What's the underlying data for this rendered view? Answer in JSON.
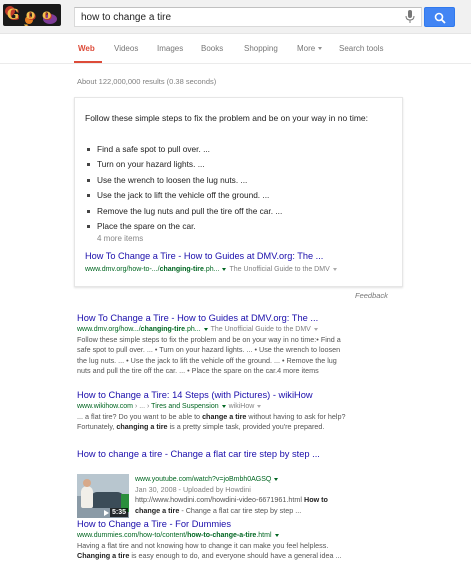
{
  "search": {
    "query": "how to change a tire",
    "logo_text": "G␣␣GLE"
  },
  "tabs": [
    {
      "label": "Web",
      "active": true
    },
    {
      "label": "Videos"
    },
    {
      "label": "Images"
    },
    {
      "label": "Books"
    },
    {
      "label": "Shopping"
    },
    {
      "label": "More"
    },
    {
      "label": "Search tools"
    }
  ],
  "stats": "About 122,000,000 results (0.38 seconds)",
  "answer_card": {
    "intro": "Follow these simple steps to fix the problem and be on your way in no time:",
    "steps": [
      "Find a safe spot to pull over. ...",
      "Turn on your hazard lights. ...",
      "Use the wrench to loosen the lug nuts. ...",
      "Use the jack to lift the vehicle off the ground. ...",
      "Remove the lug nuts and pull the tire off the car. ...",
      "Place the spare on the car."
    ],
    "more_items": "4 more items",
    "title": "How To Change a Tire - How to Guides at DMV.org: The ...",
    "url_prefix": "www.dmv.org/how-to-.../",
    "url_bold": "changing-tire",
    "url_suffix": ".ph...",
    "source": "The Unofficial Guide to the DMV",
    "feedback": "Feedback"
  },
  "results": [
    {
      "title": "How To Change a Tire - How to Guides at DMV.org: The ...",
      "url_prefix": "www.dmv.org/how.../",
      "url_bold": "changing-tire",
      "url_suffix": ".ph...",
      "source": "The Unofficial Guide to the DMV",
      "snippet_1": "Follow these simple steps to fix the problem and be on your way in no time:• Find a",
      "snippet_2": "safe spot to pull over. ... • Turn on your hazard lights. ... • Use the wrench to loosen",
      "snippet_3": "the lug nuts. ... • Use the jack to lift the vehicle off the ground. ... • Remove the lug",
      "snippet_4": "nuts and pull the tire off the car. ... • Place the spare on the car.4 more items"
    },
    {
      "title": "How to Change a Tire: 14 Steps (with Pictures) - wikiHow",
      "url": "www.wikihow.com",
      "breadcrumb_sep": " › ... › ",
      "breadcrumb": "Tires and Suspension",
      "source": "wikiHow",
      "snippet_1": "... a flat tire? Do you want to be able to ",
      "snippet_1_bold": "change a tire",
      "snippet_1_end": " without having to ask for help?",
      "snippet_2": "Fortunately, ",
      "snippet_2_bold": "changing a tire",
      "snippet_2_end": " is a pretty simple task, provided you're prepared."
    },
    {
      "title": "How to change a tire - Change a flat car tire step by step ...",
      "url": "www.youtube.com/watch?v=joBmbh0AGSQ",
      "date_line": "Jan 30, 2008 - Uploaded by Howdini",
      "snippet_1": "http://www.howdini.com/howdini-video-6671961.html ",
      "snippet_1_bold": "How to",
      "snippet_2_bold": "change a tire",
      "snippet_2_end": " - Change a flat car tire step by step ...",
      "duration": "5:35"
    },
    {
      "title": "How to Change a Tire - For Dummies",
      "url_prefix": "www.dummies.com/how-to/content/",
      "url_bold": "how-to-change-a-tire",
      "url_suffix": ".html",
      "snippet_1": "Having a flat tire and not knowing how to change it can make you feel helpless.",
      "snippet_2_bold": "Changing a tire",
      "snippet_2_end": " is easy enough to do, and everyone should have a general idea ..."
    }
  ],
  "colors": {
    "link": "#1a0dab",
    "url_green": "#006621",
    "active_tab": "#dd4b39",
    "search_button": "#4285f4"
  }
}
